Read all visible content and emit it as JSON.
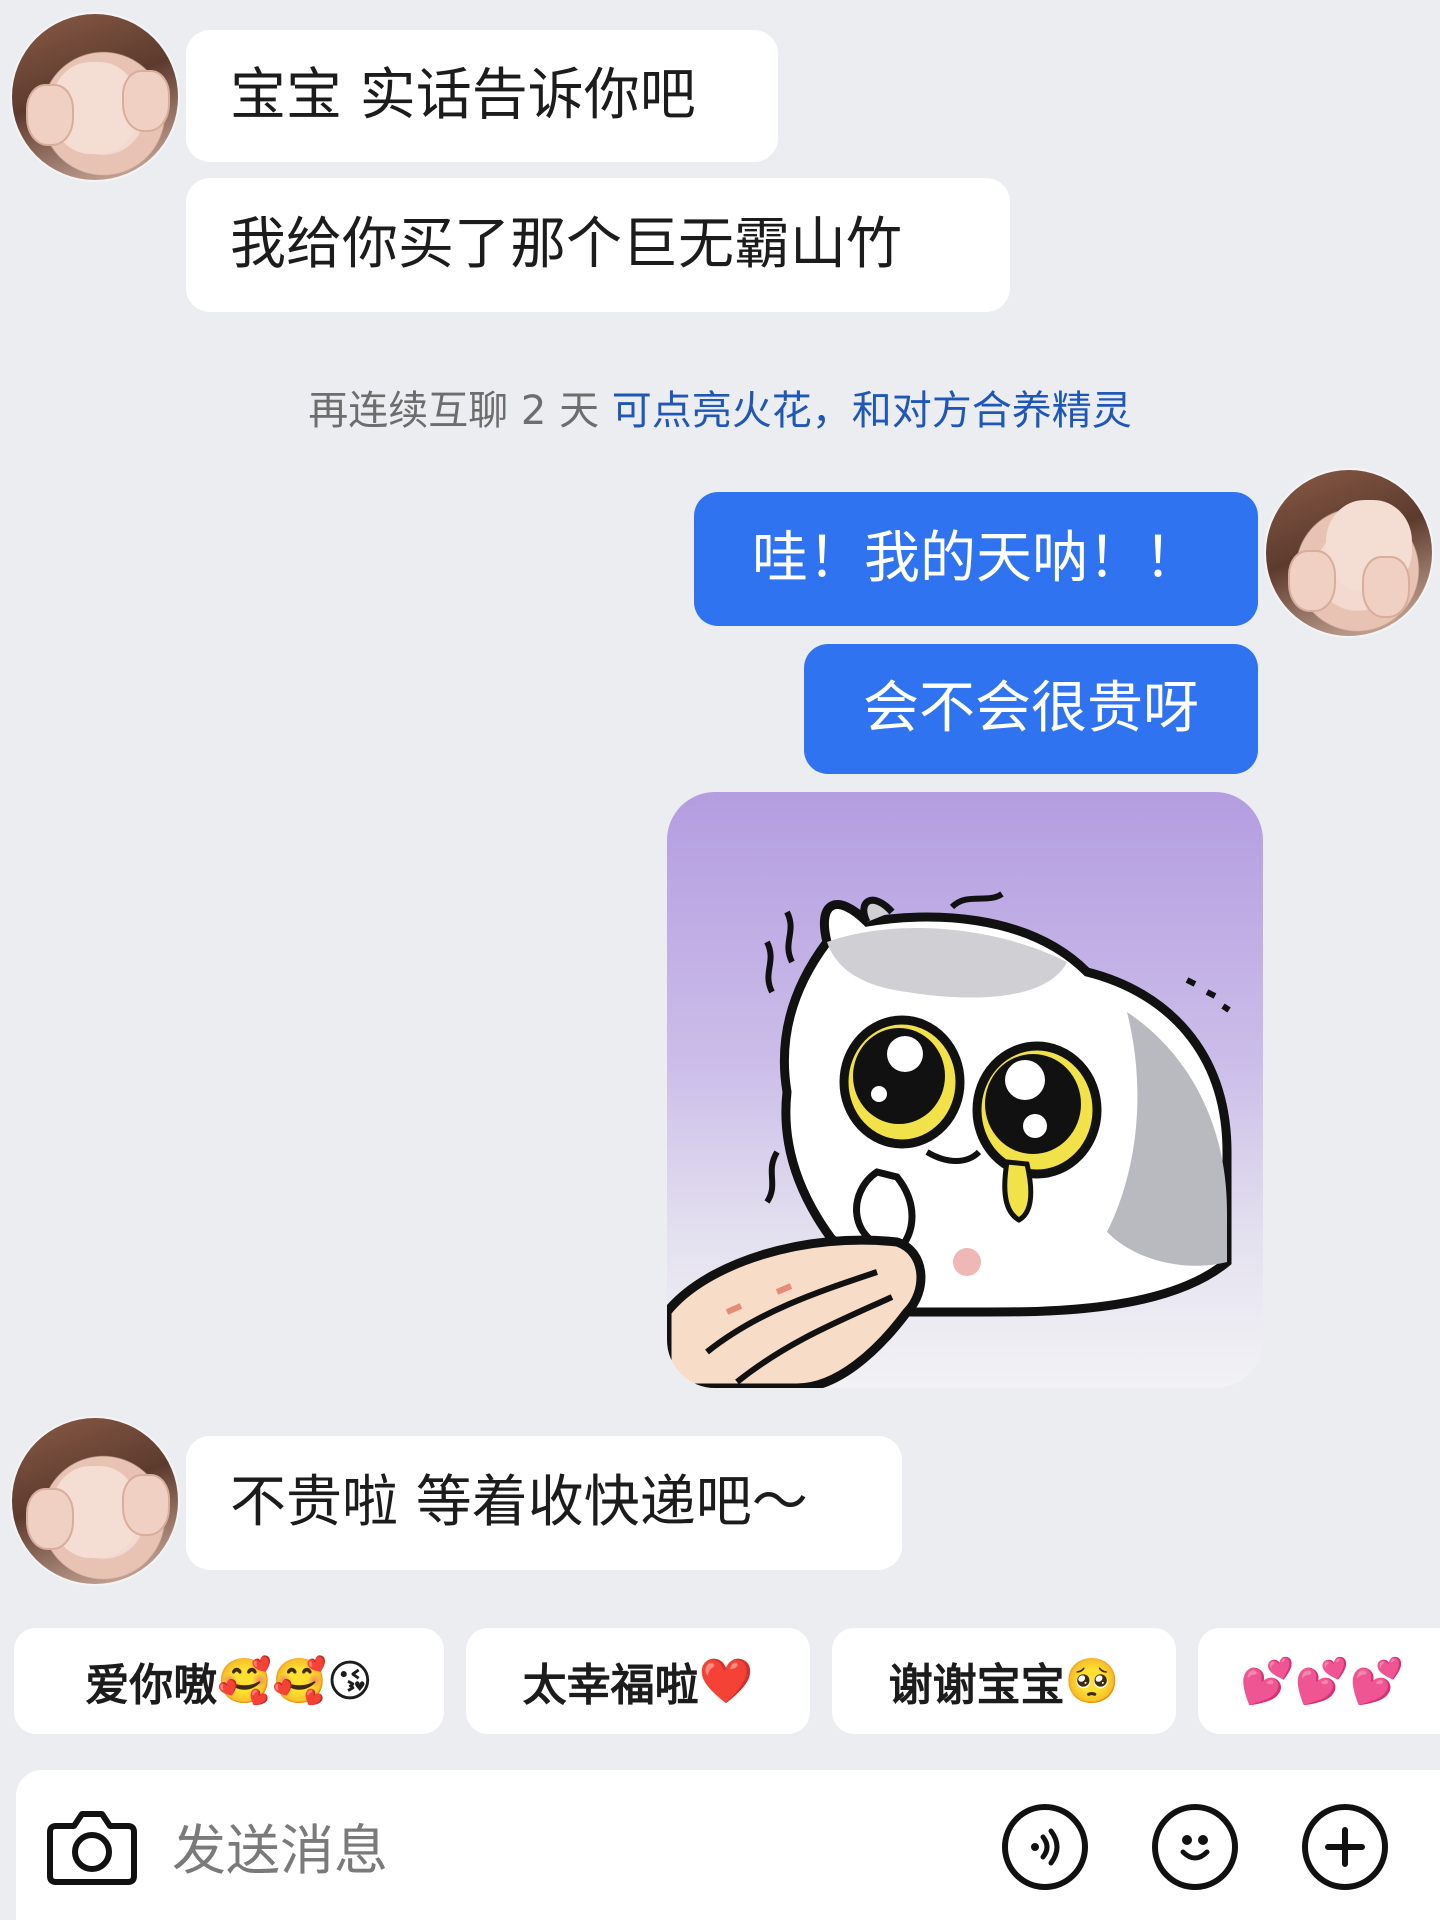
{
  "messages": [
    {
      "side": "in",
      "text": "宝宝 实话告诉你吧"
    },
    {
      "side": "in",
      "text": "我给你买了那个巨无霸山竹"
    },
    {
      "side": "out",
      "text": "哇！我的天呐！！"
    },
    {
      "side": "out",
      "text": "会不会很贵呀"
    },
    {
      "side": "in",
      "text": "不贵啦 等着收快递吧～"
    }
  ],
  "notice": {
    "prefix": "再连续互聊 2 天 ",
    "link": "可点亮火花，和对方合养精灵"
  },
  "sticker": {
    "icon": "crying-cat-sticker"
  },
  "quick_replies": [
    {
      "text": "爱你嗷",
      "emoji": "🥰🥰😘"
    },
    {
      "text": "太幸福啦",
      "emoji": "❤️"
    },
    {
      "text": "谢谢宝宝",
      "emoji": "🥺"
    },
    {
      "text": "",
      "emoji": "💕💕💕"
    }
  ],
  "composer": {
    "placeholder": "发送消息",
    "icons": [
      "camera-icon",
      "voice-icon",
      "emoji-icon",
      "plus-icon"
    ]
  },
  "colors": {
    "background": "#ecedf0",
    "incoming_bubble": "#ffffff",
    "outgoing_bubble": "#2f73f0",
    "notice_link": "#1f57b8"
  }
}
